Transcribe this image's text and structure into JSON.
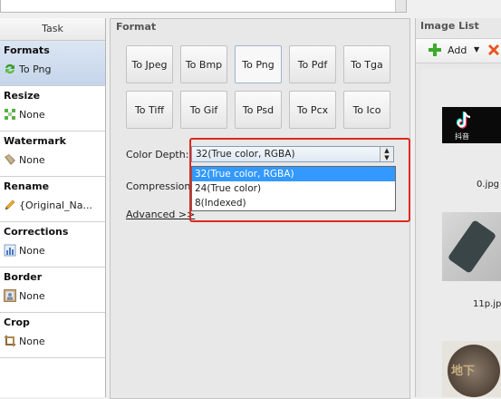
{
  "task_panel": {
    "header": "Task",
    "sections": [
      {
        "title": "Formats",
        "value": "To Png"
      },
      {
        "title": "Resize",
        "value": "None"
      },
      {
        "title": "Watermark",
        "value": "None"
      },
      {
        "title": "Rename",
        "value": "{Original_Na..."
      },
      {
        "title": "Corrections",
        "value": "None"
      },
      {
        "title": "Border",
        "value": "None"
      },
      {
        "title": "Crop",
        "value": "None"
      }
    ]
  },
  "format_panel": {
    "title": "Format",
    "buttons": [
      "To Jpeg",
      "To Bmp",
      "To Png",
      "To Pdf",
      "To Tga",
      "To Tiff",
      "To Gif",
      "To Psd",
      "To Pcx",
      "To Ico"
    ],
    "selected_button": "To Png",
    "color_depth_label": "Color Depth:",
    "color_depth_value": "32(True color, RGBA)",
    "color_depth_options": [
      "32(True color, RGBA)",
      "24(True color)",
      "8(Indexed)"
    ],
    "compression_label": "Compression:",
    "advanced_link": "Advanced >>"
  },
  "image_list": {
    "title": "Image List",
    "add_label": "Add",
    "thumb_text_1": "抖音",
    "thumb_text_3": "地下",
    "captions": [
      "0.jpg",
      "11p.jpg"
    ]
  },
  "colors": {
    "accent": "#3399ff",
    "highlight_box": "#e0281e",
    "selected_bg": "#c5d5ea"
  }
}
